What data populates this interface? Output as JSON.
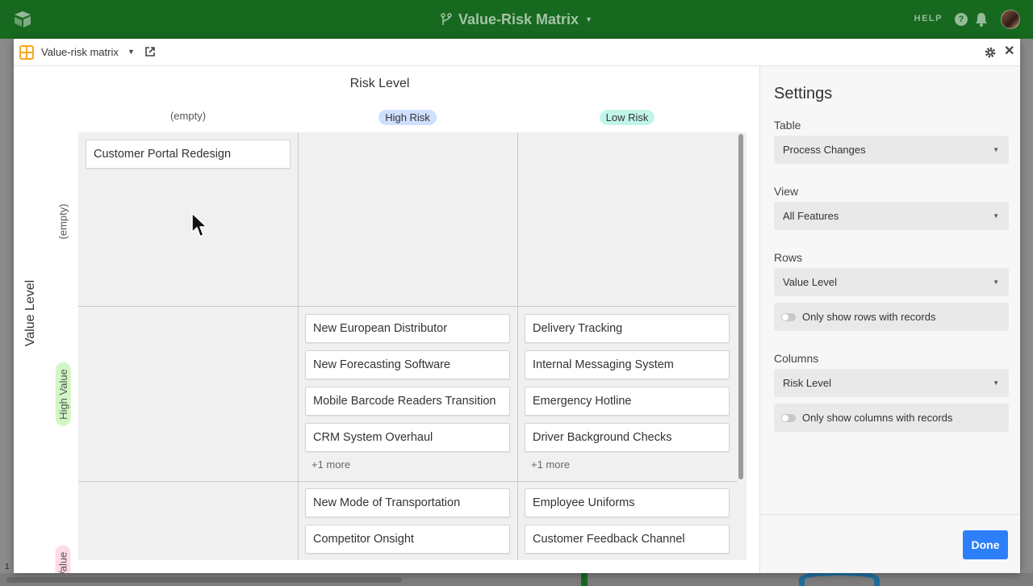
{
  "app": {
    "base_title": "Value-Risk Matrix",
    "help_label": "HELP"
  },
  "block": {
    "name": "Value-risk matrix"
  },
  "matrix": {
    "x_axis_title": "Risk Level",
    "y_axis_title": "Value Level",
    "columns": [
      {
        "label": "(empty)",
        "pill": false
      },
      {
        "label": "High Risk",
        "pill": true,
        "color": "#cfdfff"
      },
      {
        "label": "Low Risk",
        "pill": true,
        "color": "#c2f5e9"
      }
    ],
    "rows": [
      {
        "label": "(empty)",
        "pill": false
      },
      {
        "label": "High Value",
        "pill": true,
        "color": "#d1f7c4"
      },
      {
        "label": "Low Value",
        "pill": true,
        "color": "#ffdce5"
      }
    ],
    "cells": {
      "empty_empty": [
        "Customer Portal Redesign"
      ],
      "high_value_high_risk": [
        "New European Distributor",
        "New Forecasting Software",
        "Mobile Barcode Readers Transition",
        "CRM System Overhaul"
      ],
      "high_value_high_risk_more": "+1 more",
      "high_value_low_risk": [
        "Delivery Tracking",
        "Internal Messaging System",
        "Emergency Hotline",
        "Driver Background Checks"
      ],
      "high_value_low_risk_more": "+1 more",
      "low_value_high_risk": [
        "New Mode of Transportation",
        "Competitor Onsight"
      ],
      "low_value_low_risk": [
        "Employee Uniforms",
        "Customer Feedback Channel"
      ]
    }
  },
  "settings": {
    "title": "Settings",
    "table_label": "Table",
    "table_value": "Process Changes",
    "view_label": "View",
    "view_value": "All Features",
    "rows_label": "Rows",
    "rows_value": "Value Level",
    "rows_toggle": "Only show rows with records",
    "columns_label": "Columns",
    "columns_value": "Risk Level",
    "columns_toggle": "Only show columns with records",
    "done_label": "Done"
  },
  "background": {
    "row_number": "1"
  },
  "colors": {
    "topbar": "#17691f",
    "primary_button": "#2d7ff9",
    "block_icon": "#f7a722"
  }
}
